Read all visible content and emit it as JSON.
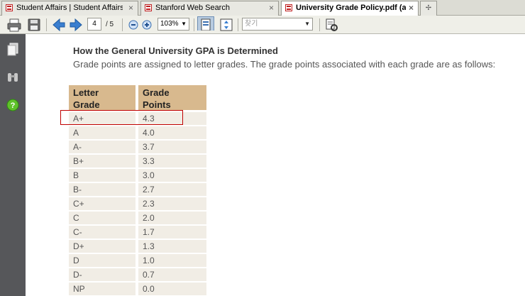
{
  "tabs": [
    {
      "label": "Student Affairs | Student Affairs",
      "active": false
    },
    {
      "label": "Stanford Web Search",
      "active": false
    },
    {
      "label": "University Grade Policy.pdf (a...",
      "active": true
    }
  ],
  "toolbar": {
    "page_current": "4",
    "page_total": "/ 5",
    "zoom": "103%",
    "search_placeholder": "찾기"
  },
  "document": {
    "title": "How the General University GPA is Determined",
    "intro": "Grade points are assigned to letter grades. The grade points associated with each grade are as follows:",
    "table": {
      "headers": [
        "Letter\nGrade",
        "Grade\nPoints"
      ],
      "rows": [
        [
          "A+",
          "4.3"
        ],
        [
          "A",
          "4.0"
        ],
        [
          "A-",
          "3.7"
        ],
        [
          "B+",
          "3.3"
        ],
        [
          "B",
          "3.0"
        ],
        [
          "B-",
          "2.7"
        ],
        [
          "C+",
          "2.3"
        ],
        [
          "C",
          "2.0"
        ],
        [
          "C-",
          "1.7"
        ],
        [
          "D+",
          "1.3"
        ],
        [
          "D",
          "1.0"
        ],
        [
          "D-",
          "0.7"
        ],
        [
          "NP",
          "0.0"
        ]
      ]
    }
  },
  "colors": {
    "header_fill": "#d8b98e",
    "row_fill": "#f1ede5",
    "highlight": "#c00000",
    "sidebar": "#56575a"
  }
}
